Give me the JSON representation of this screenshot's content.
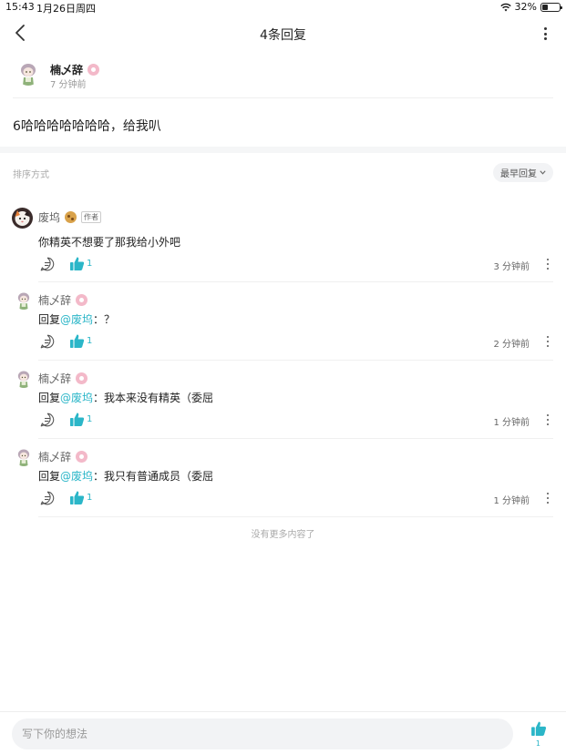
{
  "status_bar": {
    "time": "15:43",
    "date": "1月26日周四",
    "battery": "32%"
  },
  "nav": {
    "title": "4条回复"
  },
  "post": {
    "author": "楠乄辞",
    "time": "7 分钟前",
    "content": "6哈哈哈哈哈哈哈，给我叭"
  },
  "sort": {
    "label": "排序方式",
    "selected": "最早回复"
  },
  "comments": [
    {
      "author": "废坞",
      "author_tag": "作者",
      "text": "你精英不想要了那我给小外吧",
      "likes": "1",
      "time": "3 分钟前"
    },
    {
      "author": "楠乄辞",
      "prefix": "回复",
      "mention": "@废坞",
      "text": "：？",
      "likes": "1",
      "time": "2 分钟前"
    },
    {
      "author": "楠乄辞",
      "prefix": "回复",
      "mention": "@废坞",
      "text": "：我本来没有精英（委屈",
      "likes": "1",
      "time": "1 分钟前"
    },
    {
      "author": "楠乄辞",
      "prefix": "回复",
      "mention": "@废坞",
      "text": "：我只有普通成员（委屈",
      "likes": "1",
      "time": "1 分钟前"
    }
  ],
  "footer_note": "没有更多内容了",
  "bottom": {
    "input_placeholder": "写下你的想法",
    "like_count": "1"
  },
  "colors": {
    "accent": "#2bb6c8",
    "badge_pink": "#f3b9c9"
  }
}
